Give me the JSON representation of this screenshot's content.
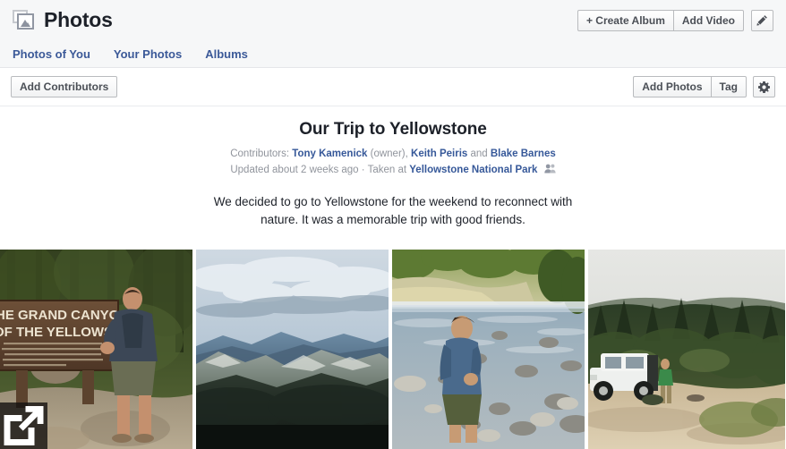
{
  "header": {
    "title": "Photos",
    "logo_icon": "photos-stack-icon",
    "create_album_label": "+ Create Album",
    "add_video_label": "Add Video",
    "edit_icon": "pencil-icon"
  },
  "nav": {
    "items": [
      {
        "label": "Photos of You"
      },
      {
        "label": "Your Photos"
      },
      {
        "label": "Albums"
      }
    ]
  },
  "toolbar": {
    "add_contributors_label": "Add Contributors",
    "add_photos_label": "Add Photos",
    "tag_label": "Tag",
    "settings_icon": "gear-icon"
  },
  "album": {
    "title": "Our Trip to Yellowstone",
    "contributors_prefix": "Contributors:",
    "contributor_owner": "Tony Kamenick",
    "owner_suffix": " (owner), ",
    "contributor_2": "Keith Peiris",
    "contributor_join": " and ",
    "contributor_3": "Blake Barnes",
    "updated_text": "Updated about 2 weeks ago · Taken at ",
    "location": "Yellowstone National Park",
    "privacy_icon": "friends-privacy-icon",
    "description": "We decided to go to Yellowstone for the weekend to reconnect with nature. It was a memorable trip with good friends."
  },
  "photos": [
    {
      "alt": "Man posing beside The Grand Canyon of the Yellowstone sign in the forest",
      "sign_line_1": "HE GRAND CANYON",
      "sign_line_2": "OF THE YELLOWSTONE",
      "has_expand_overlay": true,
      "expand_icon": "expand-open-icon"
    },
    {
      "alt": "Cloudy sky over layered blue mountain ridges",
      "has_expand_overlay": false
    },
    {
      "alt": "Man in blue shirt walking along a rocky river bank",
      "has_expand_overlay": false
    },
    {
      "alt": "White Jeep parked on a dirt clearing before a pine forest",
      "has_expand_overlay": false
    }
  ],
  "colors": {
    "brand_blue": "#3b5998",
    "link_blue": "#365899",
    "chrome_bg": "#f6f7f8",
    "text_dark": "#1d2129",
    "text_muted": "#90949c"
  }
}
